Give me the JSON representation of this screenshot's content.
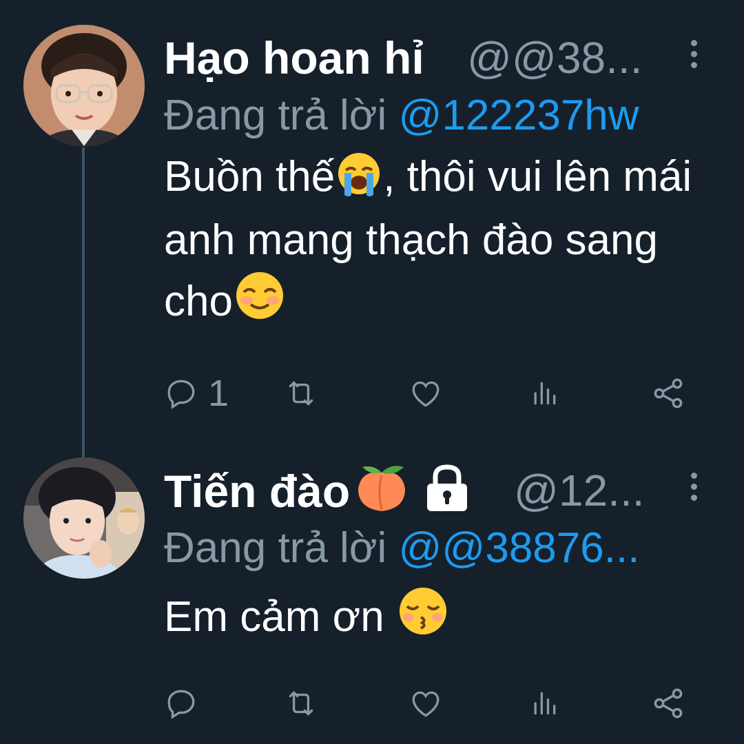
{
  "colors": {
    "background": "#15202b",
    "secondary_text": "#8899a6",
    "link": "#1d9bf0",
    "thread_line": "#3d5466"
  },
  "tweets": [
    {
      "display_name": "Hạo hoan hỉ",
      "handle": "@@38...",
      "reply_prefix": "Đang trả lời",
      "reply_target": "@122237hw",
      "text_parts": [
        "Buồn thế",
        ", thôi vui lên mái anh mang thạch đào sang cho"
      ],
      "emojis": [
        "loudly-crying-face",
        "smiling-face-with-blush"
      ],
      "actions": {
        "reply_count": "1",
        "icons": [
          "reply-icon",
          "retweet-icon",
          "like-icon",
          "analytics-icon",
          "share-icon"
        ]
      }
    },
    {
      "display_name": "Tiến đào",
      "name_badges": [
        "peach-emoji",
        "lock-icon"
      ],
      "handle": "@12...",
      "reply_prefix": "Đang trả lời",
      "reply_target": "@@38876...",
      "text_parts": [
        "Em cảm ơn "
      ],
      "emojis": [
        "kissing-face-with-closed-eyes"
      ],
      "actions": {
        "reply_count": "",
        "icons": [
          "reply-icon",
          "retweet-icon",
          "like-icon",
          "analytics-icon",
          "share-icon"
        ]
      }
    }
  ]
}
